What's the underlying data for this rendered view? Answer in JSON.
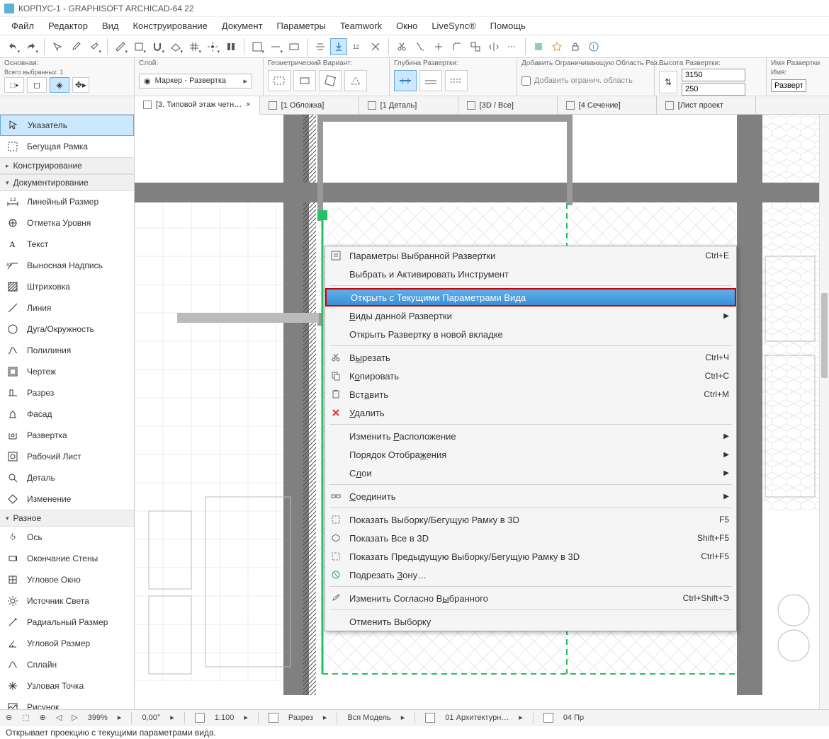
{
  "title": "КОРПУС-1 - GRAPHISOFT ARCHICAD-64 22",
  "menu": [
    "Файл",
    "Редактор",
    "Вид",
    "Конструирование",
    "Документ",
    "Параметры",
    "Teamwork",
    "Окно",
    "LiveSync®",
    "Помощь"
  ],
  "infobar": {
    "main_label": "Основная:",
    "selected_label": "Всего выбранных: 1",
    "layer_label": "Слой:",
    "layer_value": "Маркер - Развертка",
    "geom_label": "Геометрический Вариант:",
    "depth_label": "Глубина Развертки:",
    "bound_label": "Добавить Ограничивающую Область Раз…",
    "bound_check": "Добавить огранич. область",
    "height_label": "Высота Развертки:",
    "height_top": "3150",
    "height_bottom": "250",
    "name_label": "Имя Развертки",
    "name_sublabel": "Имя:",
    "name_value": "Развертк"
  },
  "tabs": [
    {
      "label": "[3. Типовой этаж четн…",
      "active": true,
      "closable": true
    },
    {
      "label": "[1 Обложка]",
      "active": false
    },
    {
      "label": "[1 Деталь]",
      "active": false
    },
    {
      "label": "[3D / Все]",
      "active": false
    },
    {
      "label": "[4 Сечение]",
      "active": false
    },
    {
      "label": "[Лист проект",
      "active": false
    }
  ],
  "toolbox": {
    "items_top": [
      {
        "label": "Указатель",
        "selected": true,
        "icon": "arrow"
      },
      {
        "label": "Бегущая Рамка",
        "icon": "marquee"
      }
    ],
    "group1": "Конструирование",
    "group2": "Документирование",
    "items_doc": [
      {
        "label": "Линейный Размер",
        "icon": "dim"
      },
      {
        "label": "Отметка Уровня",
        "icon": "level"
      },
      {
        "label": "Текст",
        "icon": "text"
      },
      {
        "label": "Выносная Надпись",
        "icon": "label"
      },
      {
        "label": "Штриховка",
        "icon": "hatch"
      },
      {
        "label": "Линия",
        "icon": "line"
      },
      {
        "label": "Дуга/Окружность",
        "icon": "arc"
      },
      {
        "label": "Полилиния",
        "icon": "poly"
      },
      {
        "label": "Чертеж",
        "icon": "drawing"
      },
      {
        "label": "Разрез",
        "icon": "section"
      },
      {
        "label": "Фасад",
        "icon": "elev"
      },
      {
        "label": "Развертка",
        "icon": "interior"
      },
      {
        "label": "Рабочий Лист",
        "icon": "worksheet"
      },
      {
        "label": "Деталь",
        "icon": "detail"
      },
      {
        "label": "Изменение",
        "icon": "change"
      }
    ],
    "group3": "Разное",
    "items_misc": [
      {
        "label": "Ось",
        "icon": "axis"
      },
      {
        "label": "Окончание Стены",
        "icon": "wallend"
      },
      {
        "label": "Угловое Окно",
        "icon": "cornerwin"
      },
      {
        "label": "Источник Света",
        "icon": "light"
      },
      {
        "label": "Радиальный Размер",
        "icon": "raddim"
      },
      {
        "label": "Угловой Размер",
        "icon": "angdim"
      },
      {
        "label": "Сплайн",
        "icon": "spline"
      },
      {
        "label": "Узловая Точка",
        "icon": "hotspot"
      },
      {
        "label": "Рисунок",
        "icon": "figure"
      }
    ]
  },
  "context_menu": [
    {
      "type": "item",
      "label": "Параметры Выбранной Развертки",
      "shortcut": "Ctrl+E",
      "icon": "settings"
    },
    {
      "type": "item",
      "label": "Выбрать и Активировать Инструмент"
    },
    {
      "type": "sep"
    },
    {
      "type": "item",
      "label": "Открыть с Текущими Параметрами Вида",
      "highlighted": true
    },
    {
      "type": "item",
      "label_html": "<u>В</u>иды данной Развертки",
      "arrow": true
    },
    {
      "type": "item",
      "label": "Открыть Развертку в новой вкладке"
    },
    {
      "type": "sep"
    },
    {
      "type": "item",
      "label_html": "В<u>ы</u>резать",
      "shortcut": "Ctrl+Ч",
      "icon": "cut"
    },
    {
      "type": "item",
      "label_html": "К<u>о</u>пировать",
      "shortcut": "Ctrl+С",
      "icon": "copy"
    },
    {
      "type": "item",
      "label_html": "Вст<u>а</u>вить",
      "shortcut": "Ctrl+М",
      "icon": "paste"
    },
    {
      "type": "item",
      "label_html": "<u>У</u>далить",
      "icon": "delete"
    },
    {
      "type": "sep"
    },
    {
      "type": "item",
      "label_html": "Изменить <u>Р</u>асположение",
      "arrow": true
    },
    {
      "type": "item",
      "label_html": "Порядок Отобра<u>ж</u>ения",
      "arrow": true
    },
    {
      "type": "item",
      "label_html": "С<u>л</u>ои",
      "arrow": true
    },
    {
      "type": "sep"
    },
    {
      "type": "item",
      "label_html": "<u>С</u>оединить",
      "arrow": true,
      "icon": "connect"
    },
    {
      "type": "sep"
    },
    {
      "type": "item",
      "label": "Показать Выборку/Бегущую Рамку в 3D",
      "shortcut": "F5",
      "icon": "show3d"
    },
    {
      "type": "item",
      "label": "Показать Все в 3D",
      "shortcut": "Shift+F5",
      "icon": "showall3d"
    },
    {
      "type": "item",
      "label": "Показать Предыдущую Выборку/Бегущую Рамку в 3D",
      "shortcut": "Ctrl+F5",
      "icon": "showprev3d"
    },
    {
      "type": "item",
      "label_html": "Подрезать <u>З</u>ону…",
      "icon": "cropzone"
    },
    {
      "type": "sep"
    },
    {
      "type": "item",
      "label_html": "Изменить Согласно В<u>ы</u>бранного",
      "shortcut": "Ctrl+Shift+Э",
      "icon": "pickup"
    },
    {
      "type": "sep"
    },
    {
      "type": "item",
      "label": "Отменить Выборку"
    }
  ],
  "status2": {
    "zoom": "399%",
    "angle": "0,00°",
    "scale": "1:100",
    "mvo": "Разрез",
    "model": "Вся Модель",
    "layer_combo": "01 Архитектурн…",
    "layout": "04 Пр"
  },
  "status": "Открывает проекцию с текущими параметрами вида."
}
